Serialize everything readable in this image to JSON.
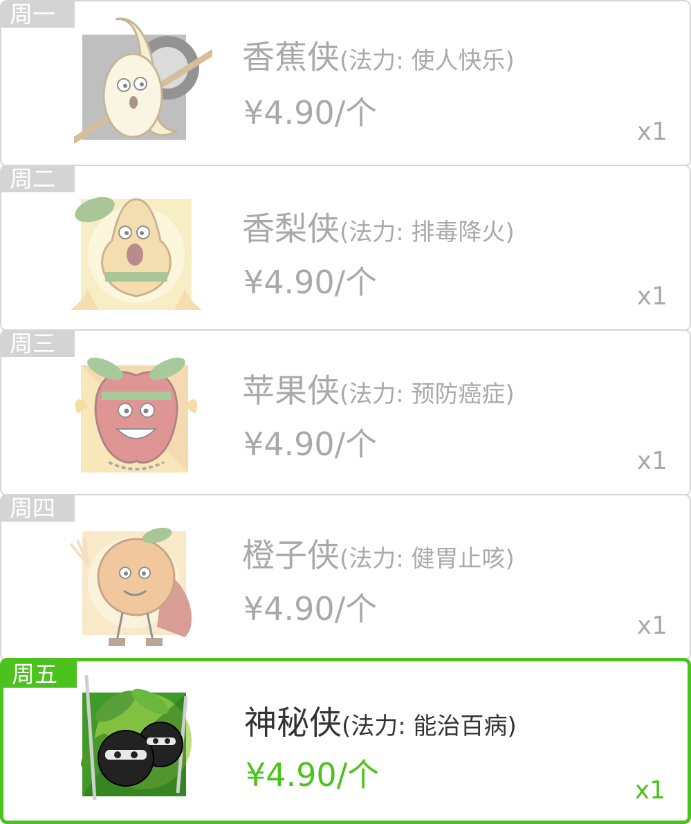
{
  "products": [
    {
      "day": "周一",
      "name": "香蕉侠",
      "power": "(法力:  使人快乐)",
      "price": "¥4.90/个",
      "qty": "x1",
      "active": false,
      "icon": "banana-hero-icon",
      "colors": {
        "bg": "#8a8a8a",
        "fruit": "#f3e3a2",
        "accent": "#caa24f"
      }
    },
    {
      "day": "周二",
      "name": "香梨侠",
      "power": "(法力:  排毒降火)",
      "price": "¥4.90/个",
      "qty": "x1",
      "active": false,
      "icon": "pear-hero-icon",
      "colors": {
        "bg": "#f6e08a",
        "fruit": "#f1c15c",
        "accent": "#5d9a3a"
      }
    },
    {
      "day": "周三",
      "name": "苹果侠",
      "power": "(法力:  预防癌症)",
      "price": "¥4.90/个",
      "qty": "x1",
      "active": false,
      "icon": "apple-hero-icon",
      "colors": {
        "bg": "#f7d36e",
        "fruit": "#d93a3a",
        "accent": "#5aa03a"
      }
    },
    {
      "day": "周四",
      "name": "橙子侠",
      "power": "(法力:  健胃止咳)",
      "price": "¥4.90/个",
      "qty": "x1",
      "active": false,
      "icon": "orange-hero-icon",
      "colors": {
        "bg": "#f7d88f",
        "fruit": "#f19a3e",
        "accent": "#c74a3a"
      }
    },
    {
      "day": "周五",
      "name": "神秘侠",
      "power": "(法力:  能治百病)",
      "price": "¥4.90/个",
      "qty": "x1",
      "active": true,
      "icon": "ninja-hero-icon",
      "colors": {
        "bg": "#3f9a2a",
        "fruit": "#222222",
        "accent": "#9fd14a"
      }
    }
  ],
  "theme": {
    "accent": "#4cc21c",
    "inactive_text": "#a9a9a9",
    "active_text": "#333333"
  }
}
